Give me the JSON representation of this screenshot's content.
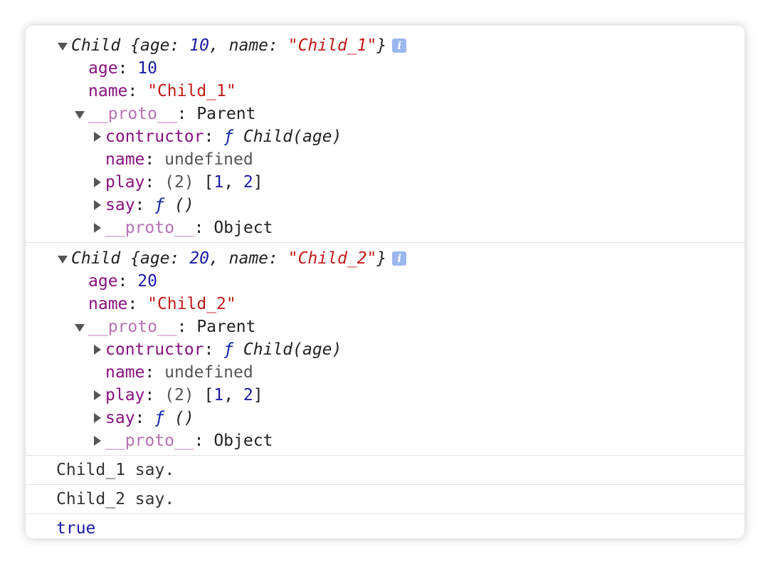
{
  "objects": [
    {
      "type": "Child",
      "summary": {
        "open": "{",
        "age_key": "age",
        "age_val": "10",
        "name_key": "name",
        "name_val": "\"Child_1\"",
        "close": "}"
      },
      "age": {
        "key": "age",
        "value": "10"
      },
      "name": {
        "key": "name",
        "value": "\"Child_1\""
      },
      "proto": {
        "key": "__proto__",
        "value": "Parent",
        "contructor": {
          "key": "contructor",
          "f": "ƒ",
          "sig": "Child(age)"
        },
        "name": {
          "key": "name",
          "value": "undefined"
        },
        "play": {
          "key": "play",
          "count": "(2)",
          "open": "[",
          "v1": "1",
          "sep": ", ",
          "v2": "2",
          "close": "]"
        },
        "say": {
          "key": "say",
          "f": "ƒ",
          "sig": "()"
        },
        "proto": {
          "key": "__proto__",
          "value": "Object"
        }
      }
    },
    {
      "type": "Child",
      "summary": {
        "open": "{",
        "age_key": "age",
        "age_val": "20",
        "name_key": "name",
        "name_val": "\"Child_2\"",
        "close": "}"
      },
      "age": {
        "key": "age",
        "value": "20"
      },
      "name": {
        "key": "name",
        "value": "\"Child_2\""
      },
      "proto": {
        "key": "__proto__",
        "value": "Parent",
        "contructor": {
          "key": "contructor",
          "f": "ƒ",
          "sig": "Child(age)"
        },
        "name": {
          "key": "name",
          "value": "undefined"
        },
        "play": {
          "key": "play",
          "count": "(2)",
          "open": "[",
          "v1": "1",
          "sep": ", ",
          "v2": "2",
          "close": "]"
        },
        "say": {
          "key": "say",
          "f": "ƒ",
          "sig": "()"
        },
        "proto": {
          "key": "__proto__",
          "value": "Object"
        }
      }
    }
  ],
  "logs": [
    {
      "text": "Child_1 say."
    },
    {
      "text": "Child_2 say."
    }
  ],
  "result": {
    "text": "true"
  },
  "info_icon_glyph": "i"
}
